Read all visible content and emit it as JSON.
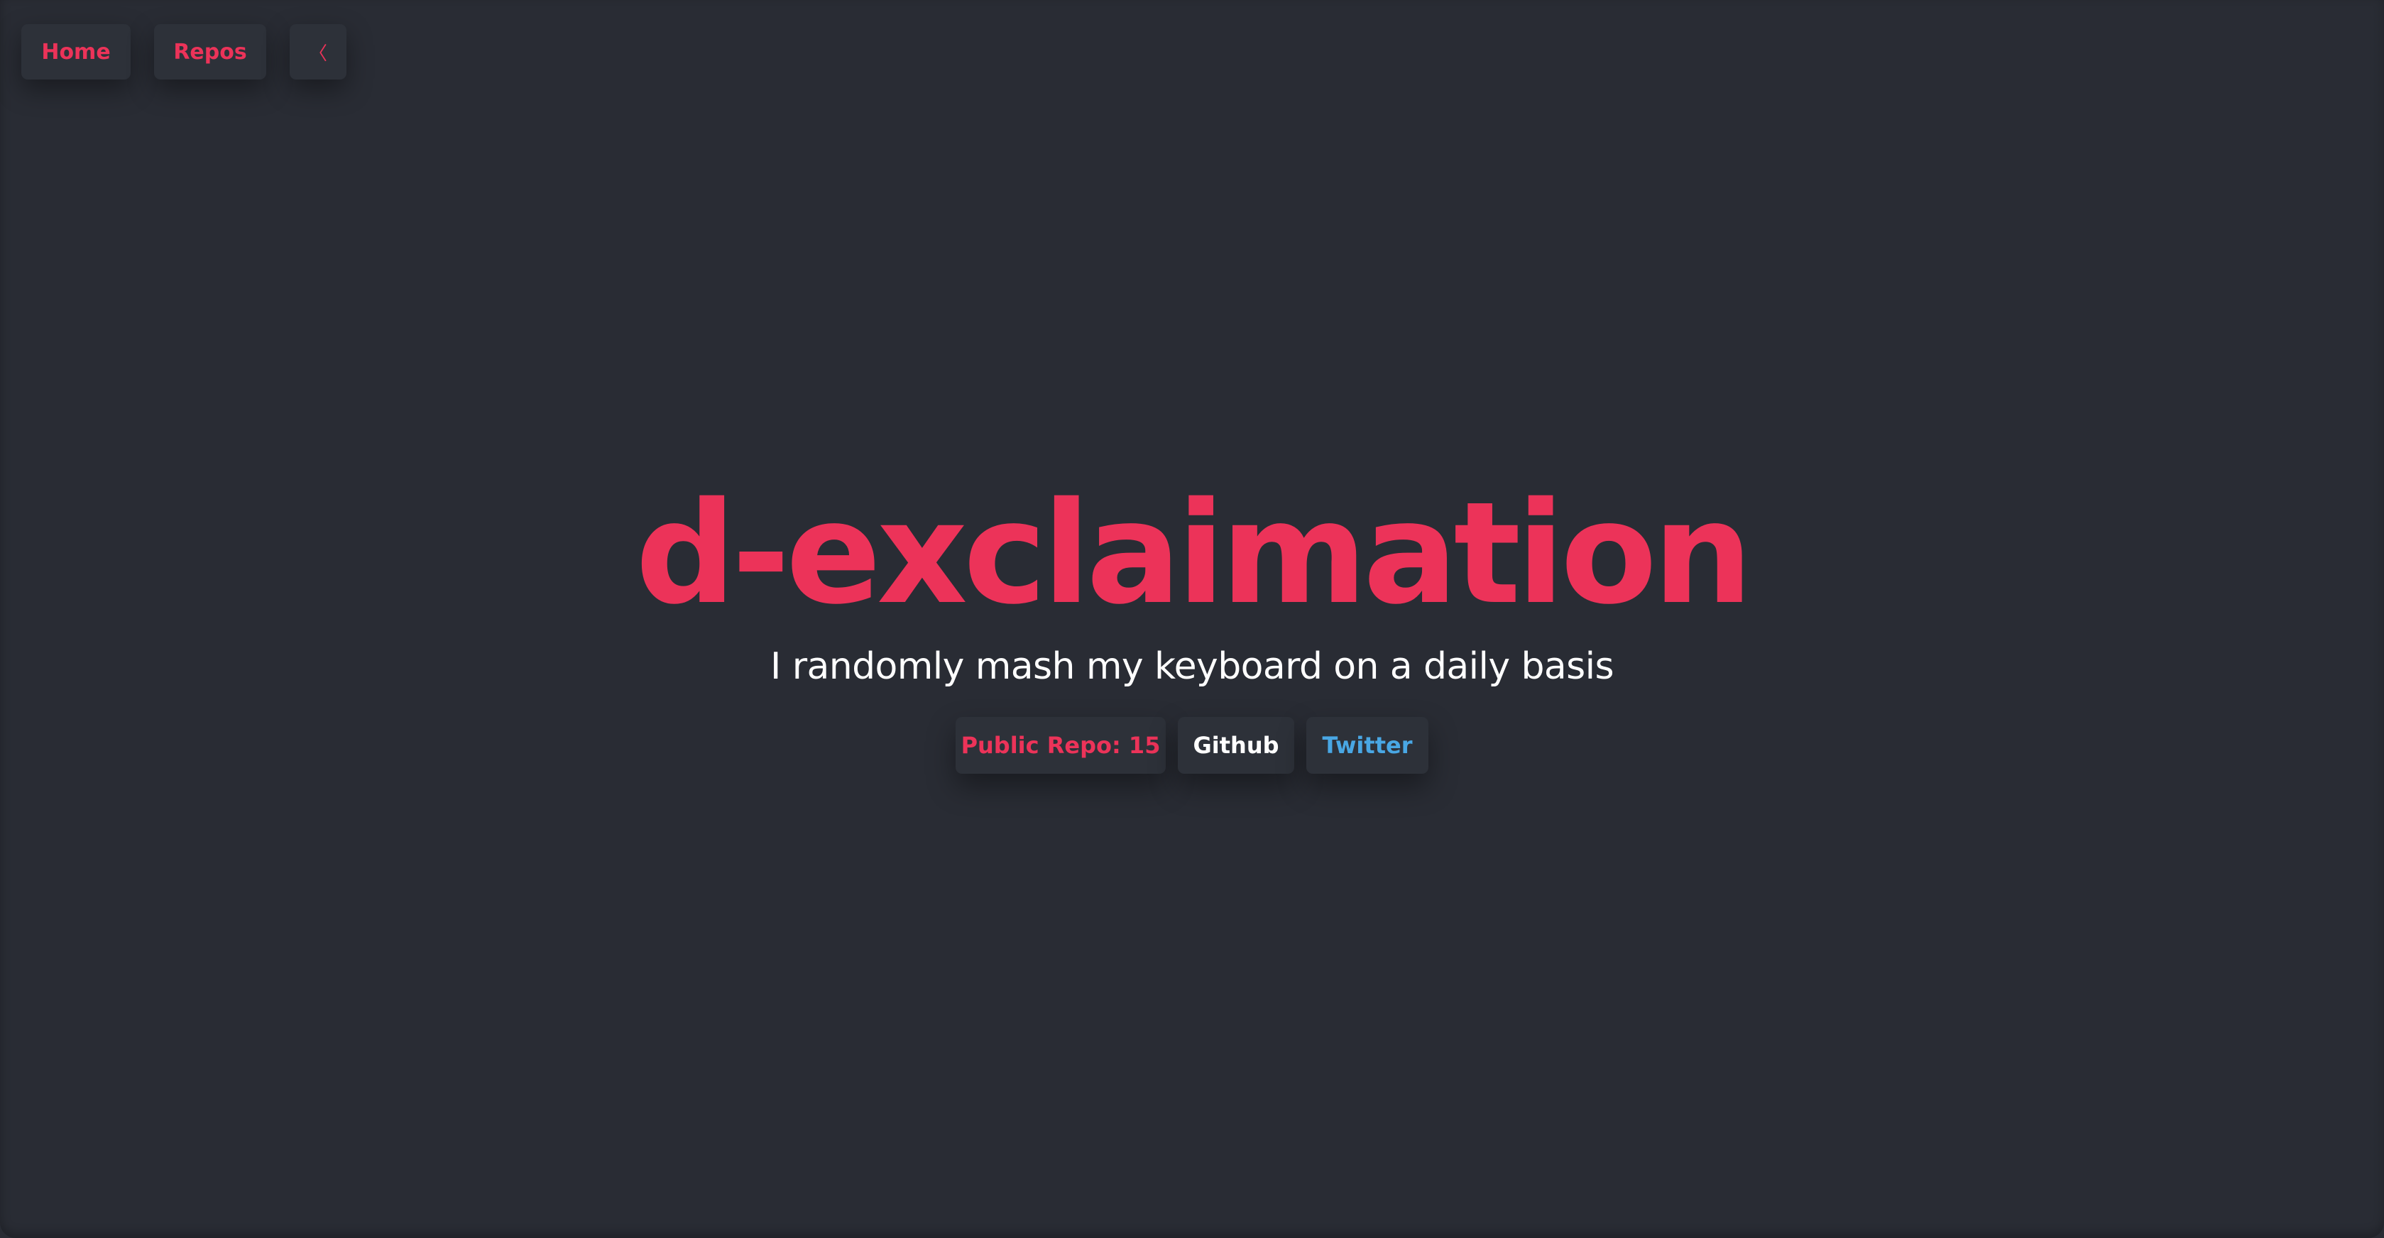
{
  "nav": {
    "home_label": "Home",
    "repos_label": "Repos",
    "collapse_icon_glyph": "〈",
    "collapse_icon": "chevron-left-icon"
  },
  "hero": {
    "title": "d-exclaimation",
    "subtitle": "I randomly mash my keyboard on a daily basis"
  },
  "links": {
    "public_repo_label": "Public Repo: 15",
    "github_label": "Github",
    "twitter_label": "Twitter"
  },
  "colors": {
    "background": "#292c34",
    "surface": "#2d3139",
    "accent": "#ec3359",
    "twitter": "#49a7e4",
    "text": "#ffffff"
  }
}
